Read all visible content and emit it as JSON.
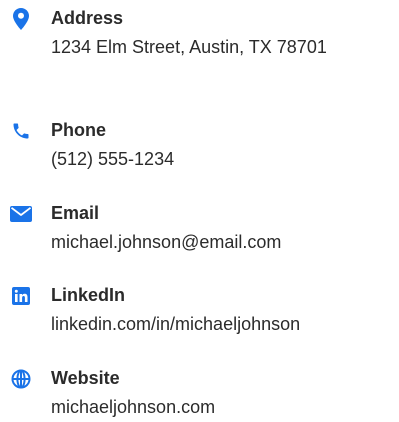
{
  "contacts": {
    "address": {
      "label": "Address",
      "value": "1234 Elm Street, Austin, TX 78701",
      "icon": "map-pin-icon"
    },
    "phone": {
      "label": "Phone",
      "value": "(512) 555-1234",
      "icon": "phone-icon"
    },
    "email": {
      "label": "Email",
      "value": "michael.johnson@email.com",
      "icon": "envelope-icon"
    },
    "linkedin": {
      "label": "LinkedIn",
      "value": "linkedin.com/in/michaeljohnson",
      "icon": "linkedin-icon"
    },
    "website": {
      "label": "Website",
      "value": "michaeljohnson.com",
      "icon": "globe-icon"
    }
  },
  "colors": {
    "icon_accent": "#1a73e8",
    "text": "#2b2b2b",
    "background": "#ffffff"
  }
}
